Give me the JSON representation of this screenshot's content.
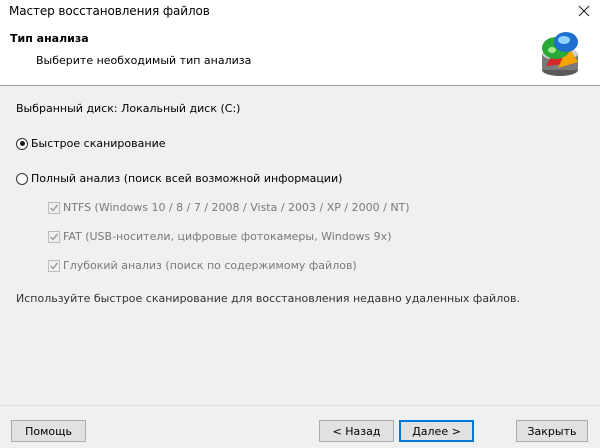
{
  "window": {
    "title": "Мастер восстановления файлов",
    "close_glyph": "✕"
  },
  "header": {
    "heading": "Тип анализа",
    "subheading": "Выберите необходимый тип анализа",
    "logo_icon": "disk-recovery-logo-icon"
  },
  "content": {
    "selected_disk": "Выбранный диск: Локальный диск (C:)",
    "options": [
      {
        "label": "Быстрое сканирование",
        "selected": true
      },
      {
        "label": "Полный анализ (поиск всей возможной информации)",
        "selected": false
      }
    ],
    "sub_options": [
      {
        "label": "NTFS (Windows 10 / 8 / 7 / 2008 / Vista / 2003 / XP / 2000 / NT)",
        "checked": true,
        "enabled": false
      },
      {
        "label": "FAT (USB-носители, цифровые фотокамеры, Windows 9x)",
        "checked": true,
        "enabled": false
      },
      {
        "label": "Глубокий анализ (поиск по содержимому файлов)",
        "checked": true,
        "enabled": false
      }
    ],
    "hint": "Используйте быстрое сканирование для восстановления недавно удаленных файлов."
  },
  "footer": {
    "help_label": "Помощь",
    "back_label": "< Назад",
    "next_label": "Далее >",
    "cancel_label": "Закрыть"
  },
  "colors": {
    "accent": "#0078d7",
    "dialog_bg": "#f0f0f0",
    "disabled_text": "#7a7a7a"
  }
}
